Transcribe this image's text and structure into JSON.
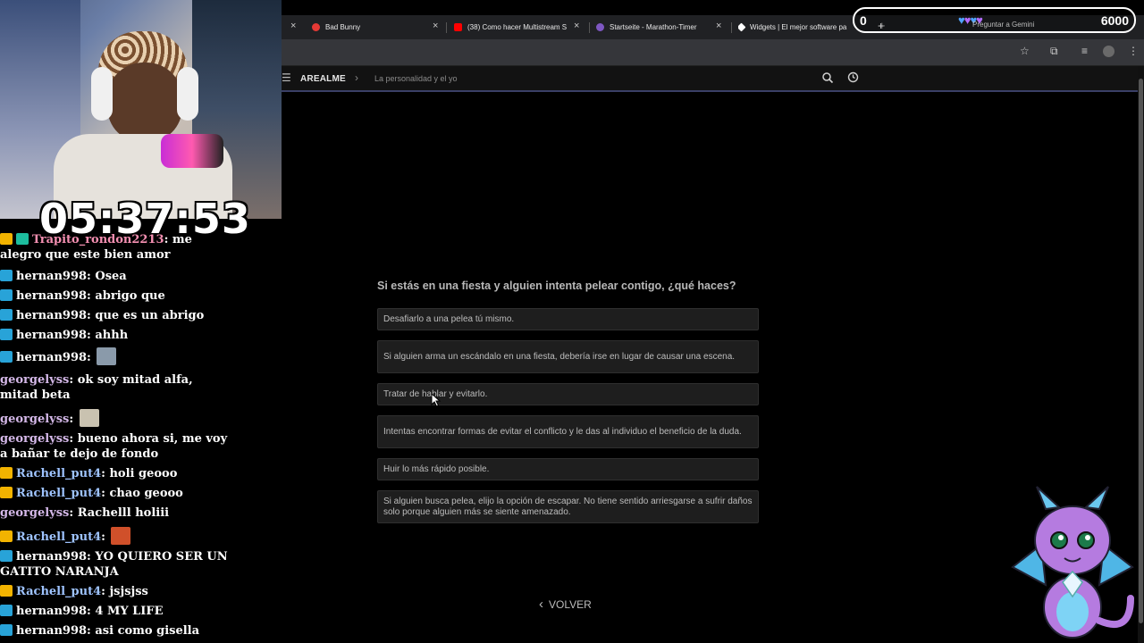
{
  "browser": {
    "tabs": [
      {
        "title": "Bad Bunny",
        "icon": "youtube-music-icon",
        "color": "#e53935"
      },
      {
        "title": "(38) Como hacer Multistream S",
        "icon": "youtube-icon",
        "color": "#ff0000"
      },
      {
        "title": "Startseite - Marathon-Timer",
        "icon": "timer-icon",
        "color": "#7e57c2"
      },
      {
        "title": "Widgets | El mejor software pa",
        "icon": "diamond-icon",
        "color": "#ffffff"
      }
    ],
    "new_tab": "+",
    "gemini_button": "Preguntar a Gemini"
  },
  "site": {
    "brand": "AREALME",
    "breadcrumb": "La personalidad y el yo"
  },
  "quiz": {
    "question": "Si estás en una fiesta y alguien intenta pelear contigo, ¿qué haces?",
    "options": [
      "Desafiarlo a una pelea tú mismo.",
      "Si alguien arma un escándalo en una fiesta, debería irse en lugar de causar una escena.",
      "Tratar de hablar y evitarlo.",
      "Intentas encontrar formas de evitar el conflicto y le das al individuo el beneficio de la duda.",
      "Huir lo más rápido posible.",
      "Si alguien busca pelea, elijo la opción de escapar. No tiene sentido arriesgarse a sufrir daños solo porque alguien más se siente amenazado."
    ],
    "back_label": "VOLVER"
  },
  "stream": {
    "timer": "05:37:53",
    "counter_left": "0",
    "counter_right": "6000"
  },
  "chat": [
    {
      "badges": [
        "gold",
        "teal"
      ],
      "user": "Trapito_rondon2213",
      "color": "#f48fb1",
      "text": "me alegro que este bien amor"
    },
    {
      "badges": [
        "blue"
      ],
      "user": "hernan998",
      "color": "#ffffff",
      "text": "Osea"
    },
    {
      "badges": [
        "blue"
      ],
      "user": "hernan998",
      "color": "#ffffff",
      "text": "abrigo que"
    },
    {
      "badges": [
        "blue"
      ],
      "user": "hernan998",
      "color": "#ffffff",
      "text": "que es un abrigo"
    },
    {
      "badges": [
        "blue"
      ],
      "user": "hernan998",
      "color": "#ffffff",
      "text": "ahhh"
    },
    {
      "badges": [
        "blue"
      ],
      "user": "hernan998",
      "color": "#ffffff",
      "text": "",
      "emote": "face-emote"
    },
    {
      "badges": [],
      "user": "georgelyss",
      "color": "#d4b8e8",
      "text": "ok soy mitad alfa, mitad beta"
    },
    {
      "badges": [],
      "user": "georgelyss",
      "color": "#d4b8e8",
      "text": "",
      "emote": "cat-emote"
    },
    {
      "badges": [],
      "user": "georgelyss",
      "color": "#d4b8e8",
      "text": "bueno ahora si, me voy a bañar te dejo de fondo"
    },
    {
      "badges": [
        "gold"
      ],
      "user": "Rachell_put4",
      "color": "#9ec3ff",
      "text": "holi geooo"
    },
    {
      "badges": [
        "gold"
      ],
      "user": "Rachell_put4",
      "color": "#9ec3ff",
      "text": "chao geooo"
    },
    {
      "badges": [],
      "user": "georgelyss",
      "color": "#d4b8e8",
      "text": "Rachelll holiii"
    },
    {
      "badges": [
        "gold"
      ],
      "user": "Rachell_put4",
      "color": "#9ec3ff",
      "text": "",
      "emote": "fire-emote"
    },
    {
      "badges": [
        "blue"
      ],
      "user": "hernan998",
      "color": "#ffffff",
      "text": "YO QUIERO SER UN GATITO NARANJA"
    },
    {
      "badges": [
        "gold"
      ],
      "user": "Rachell_put4",
      "color": "#9ec3ff",
      "text": "jsjsjss"
    },
    {
      "badges": [
        "blue"
      ],
      "user": "hernan998",
      "color": "#ffffff",
      "text": "4 MY LIFE"
    },
    {
      "badges": [
        "blue"
      ],
      "user": "hernan998",
      "color": "#ffffff",
      "text": "asi como gisella"
    }
  ]
}
